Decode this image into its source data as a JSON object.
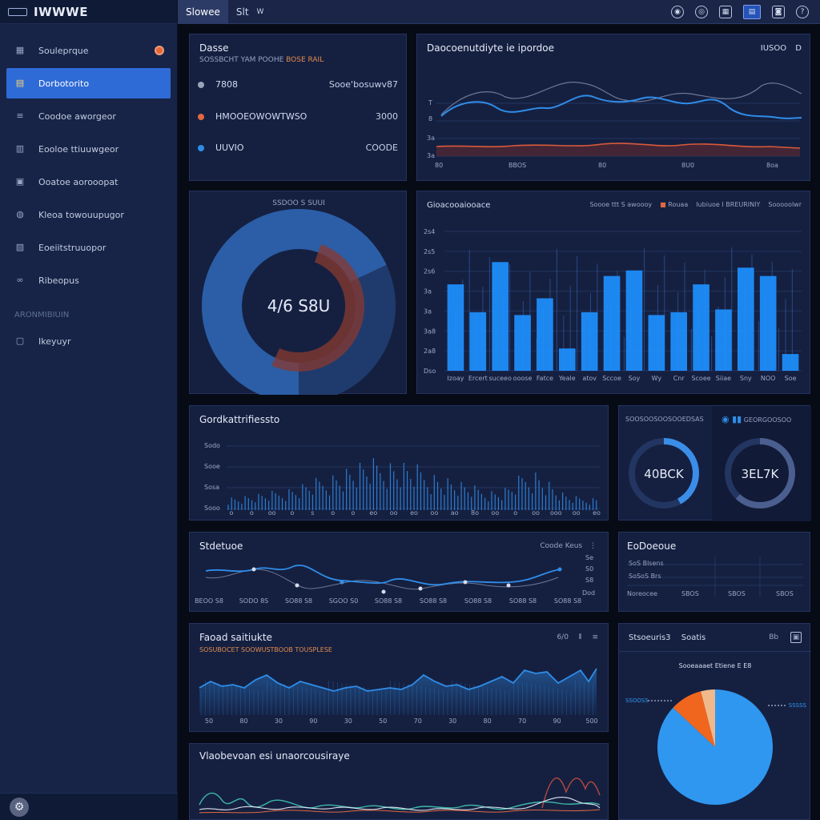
{
  "app": {
    "title": "IWWWE"
  },
  "sidebar": {
    "items": [
      {
        "label": "Souleprque",
        "icon": "grid-icon"
      },
      {
        "label": "Dorbotorito",
        "icon": "chart-icon"
      },
      {
        "label": "Coodoe aworgeor",
        "icon": "list-icon"
      },
      {
        "label": "Eooloe ttiuuwgeor",
        "icon": "table-icon"
      },
      {
        "label": "Ooatoe aorooopat",
        "icon": "folder-icon"
      },
      {
        "label": "Kleoa towouupugor",
        "icon": "user-icon"
      },
      {
        "label": "Eoeiitstruuopor",
        "icon": "report-icon"
      },
      {
        "label": "Ribeopus",
        "icon": "link-icon"
      }
    ],
    "section_label": "ARONMIBIUIN",
    "section_item": {
      "label": "Ikeyuyr",
      "icon": "doc-icon"
    }
  },
  "topbar": {
    "tabs": [
      "Slowee",
      "Slt"
    ],
    "extra": "W",
    "icons": [
      "bell-icon",
      "settings-icon",
      "grid-icon",
      "flag-icon",
      "user-icon",
      "help-icon"
    ]
  },
  "card_summary": {
    "title": "Dasse",
    "subtitle": "SOSSBCHT YAM POOHE",
    "subtitle_accent": "BOSE RAIL",
    "rows": [
      {
        "label": "7808",
        "value": "Sooe'bosuwv87",
        "color": "#9aa3b8"
      },
      {
        "label": "HMOOEOWOWTWSO",
        "value": "3000",
        "color": "#e2683e"
      },
      {
        "label": "UUVIO",
        "value": "COODE",
        "color": "#2f8de8"
      }
    ]
  },
  "card_line_top": {
    "title": "Daocoenutdiyte ie ipordoe",
    "corner": "IUSOO",
    "corner_icon": "D",
    "yticks": [
      "T",
      "8",
      "3a",
      "3a"
    ],
    "xticks": [
      "80",
      "BBOS",
      "80",
      "8U0",
      "8oa"
    ]
  },
  "card_donut": {
    "title": "SSDOO S SUUI",
    "center_value": "4/6 S8U",
    "series": [
      0.68,
      0.32
    ],
    "colors": [
      "#2b5ea6",
      "#8a3a2f"
    ]
  },
  "card_bars": {
    "title": "Gioacooaiooace",
    "legend": [
      "Soooe ttt S awoooy",
      "Rouaa",
      "Iubiuoe I BREURINIY",
      "Sooooolwr"
    ],
    "legend_colors": [
      "#e2683e",
      "#2f8de8",
      "#e2683e",
      "#c7cfe6"
    ],
    "yticks": [
      "2s4",
      "2s5",
      "2s6",
      "3a",
      "3a",
      "3a8",
      "2a8",
      "Dso"
    ],
    "xticks": [
      "Izoay",
      "Ercert",
      "suceeo",
      "ooose",
      "Fatce",
      "Yeale",
      "atov",
      "Sccoe",
      "Soy",
      "Wy",
      "Cnr",
      "Scoee",
      "Siiae",
      "Sny",
      "NOO",
      "Soe"
    ],
    "values": [
      62,
      42,
      78,
      40,
      52,
      16,
      42,
      68,
      72,
      40,
      42,
      62,
      44,
      74,
      68,
      12
    ],
    "ylim": [
      0,
      100
    ]
  },
  "card_bars2": {
    "title": "Gordkattrifiessto",
    "yticks": [
      "Sodo",
      "Sooe",
      "Sosa",
      "Sooo"
    ],
    "xticks": [
      "o",
      "o",
      "oo",
      "o",
      "s",
      "o",
      "o",
      "eo",
      "oo",
      "eo",
      "oo",
      "ao",
      "8o",
      "oo",
      "o",
      "oo",
      "ooo",
      "oo",
      "eo"
    ]
  },
  "card_gauges": {
    "label_left": "SOOSOOSOOSOOEDSAS",
    "label_right": "GEORGOOSOO",
    "gauges": [
      {
        "value_label": "40BCK",
        "fraction": 0.42
      },
      {
        "value_label": "3EL7K",
        "fraction": 0.62
      }
    ]
  },
  "card_line_mid": {
    "title": "Stdetuoe",
    "corner": "Coode  Keus",
    "yticks": [
      "Se",
      "S0",
      "S8",
      "Dod"
    ],
    "xticks": [
      "BEOO S8",
      "SODO 8S",
      "SO88 S8",
      "SGOO S0",
      "SO88 S8",
      "SO88 S8",
      "SO88 S8",
      "SO88 S8",
      "SO88 S8"
    ]
  },
  "card_table_small": {
    "title": "EoDoeoue",
    "rows": [
      "SoS Blsens",
      "SoSoS Brs"
    ],
    "xticks": [
      "Noreocee",
      "SBOS",
      "SBOS",
      "SBOS"
    ]
  },
  "card_area": {
    "title": "Faoad saitiukte",
    "subtitle": "SOSUBOCET SOOWUSTBOOB TOUSPLESE",
    "corner": "6/0",
    "xticks": [
      "50",
      "80",
      "30",
      "90",
      "30",
      "50",
      "70",
      "30",
      "80",
      "70",
      "90",
      "500"
    ]
  },
  "card_pie": {
    "title": "Stsoeuris3",
    "title2": "Soatis",
    "corner": "Bb",
    "caption": "Sooeaaaet Etiene E E8",
    "legend_left": "SSOOSS",
    "legend_right": "SSSSS",
    "slices": [
      0.87,
      0.09,
      0.04
    ],
    "colors": [
      "#2f97f0",
      "#f0661e",
      "#f0b98c"
    ]
  },
  "card_bottom": {
    "title": "Vlaobevoan  esi  unaorcousiraye"
  }
}
